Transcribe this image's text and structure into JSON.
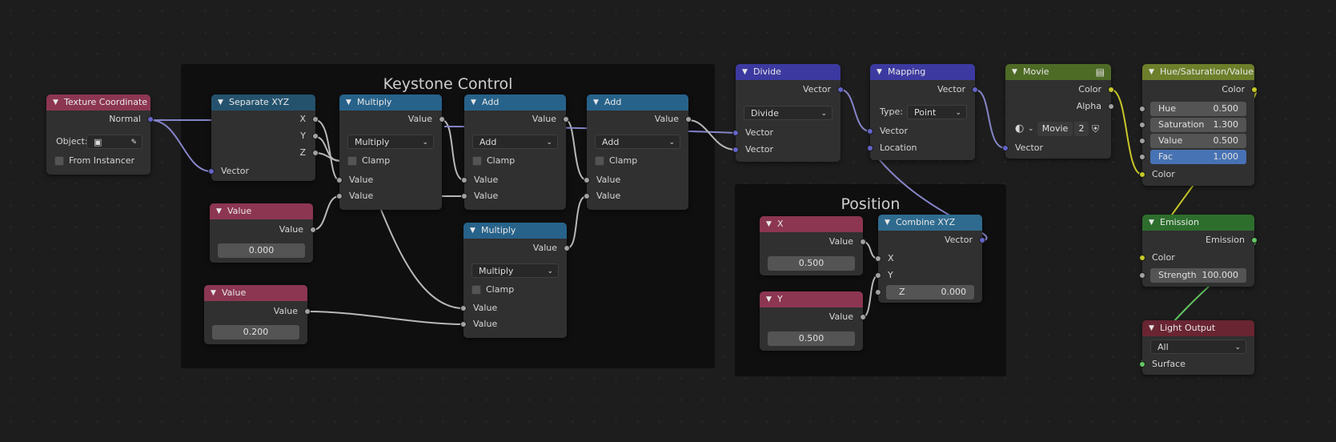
{
  "frames": {
    "keystone": "Keystone Control",
    "position": "Position"
  },
  "common": {
    "vector": "Vector",
    "value": "Value",
    "clamp": "Clamp",
    "color": "Color",
    "x": "X",
    "y": "Y",
    "z": "Z"
  },
  "nodes": {
    "texture_coordinate": {
      "title": "Texture Coordinate",
      "normal": "Normal",
      "object": "Object:",
      "from_instancer": "From Instancer"
    },
    "separate_xyz": {
      "title": "Separate XYZ"
    },
    "value1": {
      "title": "Value",
      "value": "0.000"
    },
    "value2": {
      "title": "Value",
      "value": "0.200"
    },
    "multiply1": {
      "title": "Multiply",
      "operation": "Multiply"
    },
    "add1": {
      "title": "Add",
      "operation": "Add"
    },
    "add2": {
      "title": "Add",
      "operation": "Add"
    },
    "multiply2": {
      "title": "Multiply",
      "operation": "Multiply"
    },
    "divide": {
      "title": "Divide",
      "operation": "Divide"
    },
    "mapping": {
      "title": "Mapping",
      "type_label": "Type:",
      "type_value": "Point",
      "location": "Location"
    },
    "movie": {
      "title": "Movie",
      "alpha": "Alpha",
      "image_name": "Movie",
      "users": "2"
    },
    "x_value": {
      "title": "X",
      "value": "0.500"
    },
    "y_value": {
      "title": "Y",
      "value": "0.500"
    },
    "combine_xyz": {
      "title": "Combine XYZ",
      "z_value": "0.000"
    },
    "hsv": {
      "title": "Hue/Saturation/Value",
      "hue_label": "Hue",
      "hue": "0.500",
      "saturation_label": "Saturation",
      "saturation": "1.300",
      "value_label": "Value",
      "value": "0.500",
      "fac_label": "Fac",
      "fac": "1.000"
    },
    "emission": {
      "title": "Emission",
      "emission": "Emission",
      "strength_label": "Strength",
      "strength": "100.000"
    },
    "light_output": {
      "title": "Light Output",
      "target": "All",
      "surface": "Surface"
    }
  },
  "colors": {
    "vector_socket": "#6363c7",
    "value_socket": "#a1a1a1",
    "color_socket": "#c7c729",
    "shader_socket": "#63c763",
    "active_field": "#4772b3"
  }
}
